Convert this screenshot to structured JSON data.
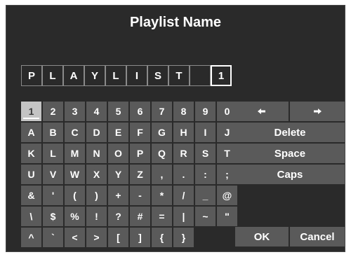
{
  "title": "Playlist Name",
  "name_slots": [
    "P",
    "L",
    "A",
    "Y",
    "L",
    "I",
    "S",
    "T",
    "",
    "1"
  ],
  "cursor_index": 9,
  "selected_key": "1",
  "keys": [
    [
      "1",
      "2",
      "3",
      "4",
      "5",
      "6",
      "7",
      "8",
      "9",
      "0"
    ],
    [
      "A",
      "B",
      "C",
      "D",
      "E",
      "F",
      "G",
      "H",
      "I",
      "J"
    ],
    [
      "K",
      "L",
      "M",
      "N",
      "O",
      "P",
      "Q",
      "R",
      "S",
      "T"
    ],
    [
      "U",
      "V",
      "W",
      "X",
      "Y",
      "Z",
      ",",
      ".",
      ":",
      ";"
    ],
    [
      "&",
      "'",
      "(",
      ")",
      "+",
      "-",
      "*",
      "/",
      "_",
      "@"
    ],
    [
      "\\",
      "$",
      "%",
      "!",
      "?",
      "#",
      "=",
      "|",
      "~",
      "\""
    ],
    [
      "^",
      "`",
      "<",
      ">",
      "[",
      "]",
      "{",
      "}"
    ]
  ],
  "functions": {
    "left_icon": "arrow-left-icon",
    "right_icon": "arrow-right-icon",
    "delete": "Delete",
    "space": "Space",
    "caps": "Caps",
    "ok": "OK",
    "cancel": "Cancel"
  }
}
